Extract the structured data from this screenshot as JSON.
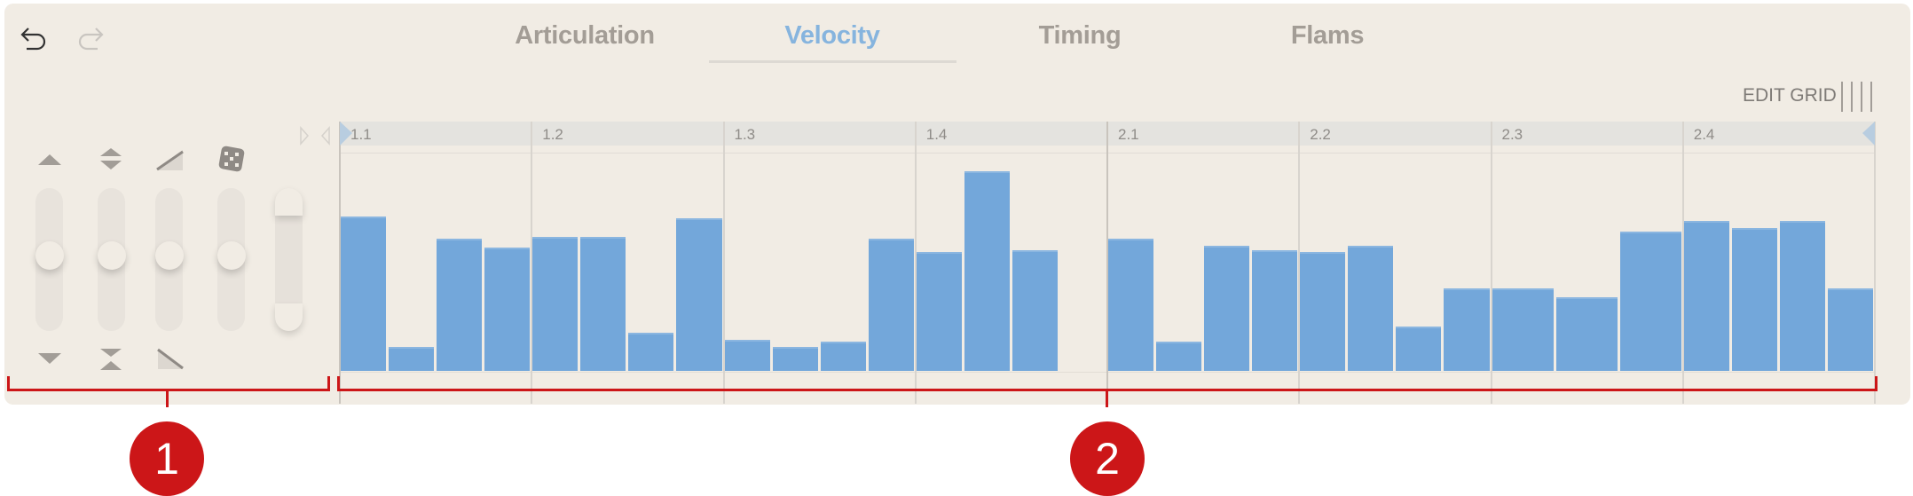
{
  "toolbar": {
    "undo_icon": "undo-arrow-icon",
    "redo_icon": "redo-arrow-icon"
  },
  "tabs": [
    {
      "label": "Articulation",
      "active": false
    },
    {
      "label": "Velocity",
      "active": true
    },
    {
      "label": "Timing",
      "active": false
    },
    {
      "label": "Flams",
      "active": false
    }
  ],
  "edit_grid": {
    "label": "EDIT GRID",
    "icon": "grid-lines-icon"
  },
  "controls": {
    "top_icons": [
      "raise-triangle-icon",
      "expand-icon",
      "ramp-up-icon",
      "dice-randomize-icon"
    ],
    "bottom_icons": [
      "lower-triangle-icon",
      "compress-icon",
      "ramp-down-icon"
    ],
    "sliders": [
      0.5,
      0.5,
      0.5,
      0.5
    ],
    "range_slider": {
      "low": 0,
      "high": 1
    }
  },
  "colors": {
    "accent": "#86b4de",
    "bar": "#73a7da",
    "background": "#f1ece4",
    "annotation": "#cc1618"
  },
  "chart_data": {
    "type": "bar",
    "ylabel": "",
    "ylim": [
      0,
      127
    ],
    "beats": [
      {
        "label": "1.1",
        "values": [
          90,
          14,
          77,
          72
        ]
      },
      {
        "label": "1.2",
        "values": [
          78,
          78,
          22,
          89
        ]
      },
      {
        "label": "1.3",
        "values": [
          18,
          14,
          17,
          77
        ]
      },
      {
        "label": "1.4",
        "values": [
          69,
          116,
          70,
          null
        ]
      },
      {
        "label": "2.1",
        "values": [
          77,
          17,
          73,
          70
        ]
      },
      {
        "label": "2.2",
        "values": [
          69,
          73,
          26,
          48
        ]
      },
      {
        "label": "2.3",
        "values": [
          48,
          43,
          81
        ]
      },
      {
        "label": "2.4",
        "values": [
          87,
          83,
          87,
          48
        ]
      }
    ]
  },
  "annotations": [
    {
      "label": "1"
    },
    {
      "label": "2"
    }
  ]
}
